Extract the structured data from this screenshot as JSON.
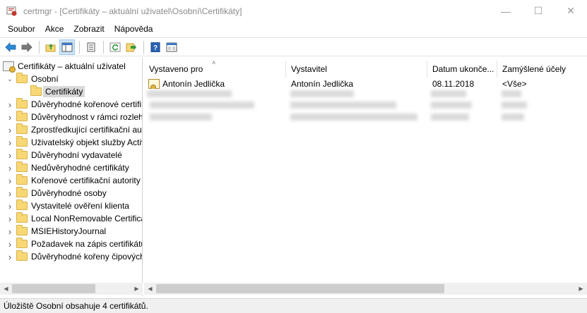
{
  "window": {
    "app_name": "certmgr",
    "title": "certmgr - [Certifikáty – aktuální uživatel\\Osobní\\Certifikáty]",
    "minimize": "—",
    "maximize": "☐",
    "close": "✕"
  },
  "menu": [
    "Soubor",
    "Akce",
    "Zobrazit",
    "Nápověda"
  ],
  "toolbar": {
    "buttons": [
      "back-icon",
      "forward-icon",
      "up-folder-icon",
      "show-hide-tree-icon",
      "properties-icon",
      "refresh-icon",
      "export-list-icon",
      "help-icon",
      "show-scope-icon"
    ]
  },
  "tree": {
    "root": "Certifikáty – aktuální uživatel",
    "personal": "Osobní",
    "personal_child": "Certifikáty",
    "items": [
      "Důvěryhodné kořenové certifikační autority",
      "Důvěryhodnost v rámci rozlehlé sítě",
      "Zprostředkující certifikační autority",
      "Uživatelský objekt služby Active Directory",
      "Důvěryhodní vydavatelé",
      "Nedůvěryhodné certifikáty",
      "Kořenové certifikační autority třetích stran",
      "Důvěryhodné osoby",
      "Vystavitelé ověření klienta",
      "Local NonRemovable Certificates",
      "MSIEHistoryJournal",
      "Požadavek na zápis certifikátu",
      "Důvěryhodné kořeny čipových karet"
    ]
  },
  "list": {
    "columns": [
      "Vystaveno pro",
      "Vystavitel",
      "Datum ukonče...",
      "Zamýšlené účely"
    ],
    "rows": [
      {
        "issued_to": "Antonín Jedlička",
        "issued_by": "Antonín Jedlička",
        "expires": "08.11.2018",
        "purposes": "<Vše>"
      }
    ]
  },
  "status": "Úložiště Osobní obsahuje 4 certifikátů."
}
